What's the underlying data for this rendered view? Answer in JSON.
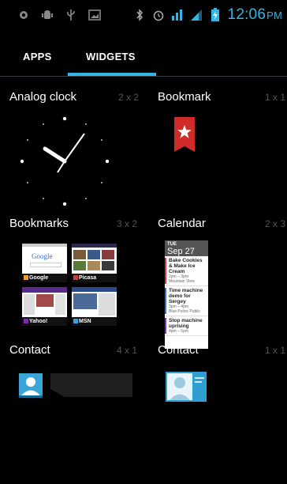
{
  "status_bar": {
    "icons_left": [
      "settings-icon",
      "android-debug-icon",
      "usb-icon",
      "screenshot-icon"
    ],
    "icons_right": [
      "bluetooth-icon",
      "alarm-icon",
      "signal-icon",
      "signal-bars-icon",
      "battery-charging-icon"
    ],
    "time": "12:06",
    "ampm": "PM",
    "accent": "#33b5e5"
  },
  "tabs": [
    {
      "label": "APPS",
      "selected": false
    },
    {
      "label": "WIDGETS",
      "selected": true
    }
  ],
  "widgets": [
    {
      "name": "Analog clock",
      "size": "2 x 2"
    },
    {
      "name": "Bookmark",
      "size": "1 x 1"
    },
    {
      "name": "Bookmarks",
      "size": "3 x 2"
    },
    {
      "name": "Calendar",
      "size": "2 x 3"
    },
    {
      "name": "Contact",
      "size": "4 x 1"
    },
    {
      "name": "Contact",
      "size": "1 x 1"
    }
  ],
  "bookmarks_preview": [
    {
      "label": "Google",
      "logo": "Google"
    },
    {
      "label": "Picasa",
      "logo": ""
    },
    {
      "label": "Yahoo!",
      "logo": ""
    },
    {
      "label": "MSN",
      "logo": ""
    }
  ],
  "calendar_preview": {
    "dow": "TUE",
    "date": "Sep 27",
    "events": [
      {
        "title": "Bake Cookies & Make Ice Cream",
        "time": "2pm – 3pm",
        "place": "Mountain View",
        "color": "#d13a3a"
      },
      {
        "title": "Time machine demo for Sergey",
        "time": "3pm – 4pm",
        "place": "Blue Police Public",
        "color": "#3a6fd1"
      },
      {
        "title": "Stop machine uprising",
        "time": "4pm – 5pm",
        "place": "",
        "color": "#6a3ad1"
      }
    ]
  }
}
